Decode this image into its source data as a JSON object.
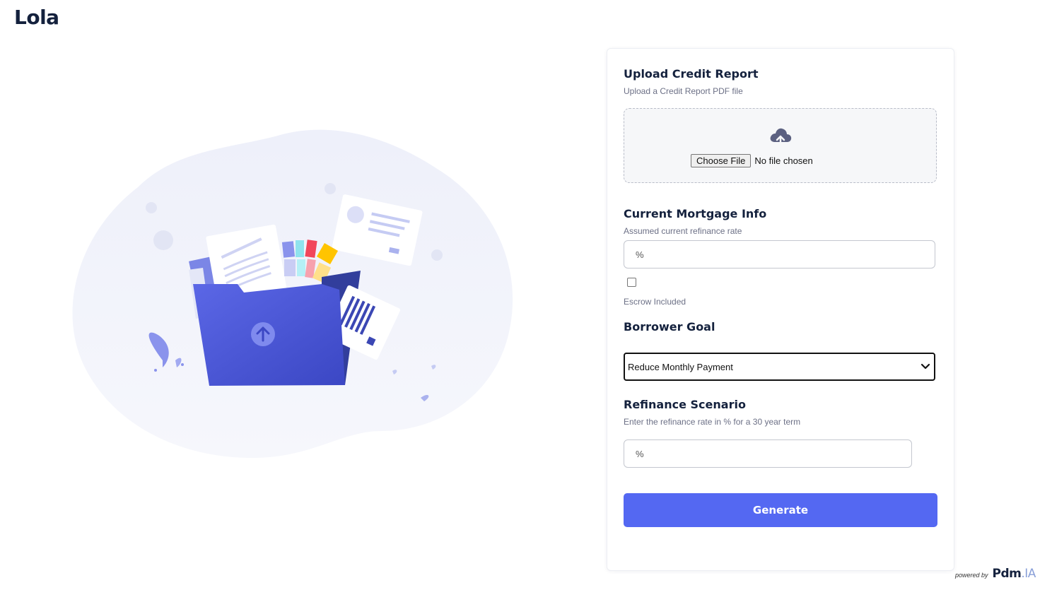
{
  "app": {
    "logo": "Lola"
  },
  "upload": {
    "title": "Upload Credit Report",
    "hint": "Upload a Credit Report PDF file",
    "choose_label": "Choose File",
    "file_status": "No file chosen",
    "icon": "cloud-upload-icon"
  },
  "mortgage": {
    "title": "Current Mortgage Info",
    "rate_label": "Assumed current refinance rate",
    "rate_placeholder": "%",
    "rate_value": "",
    "escrow_checked": false,
    "escrow_label": "Escrow Included"
  },
  "goal": {
    "title": "Borrower Goal",
    "selected": "Reduce Monthly Payment"
  },
  "scenario": {
    "title": "Refinance Scenario",
    "hint": "Enter the refinance rate in % for a 30 year term",
    "rate_placeholder": "%",
    "rate_value": ""
  },
  "actions": {
    "generate_label": "Generate"
  },
  "footer": {
    "powered_by": "powered by",
    "brand_main": "Pdm",
    "brand_suffix": ".IA"
  },
  "colors": {
    "accent": "#5468f2",
    "heading": "#14213d",
    "folder": "#4a56d8"
  }
}
